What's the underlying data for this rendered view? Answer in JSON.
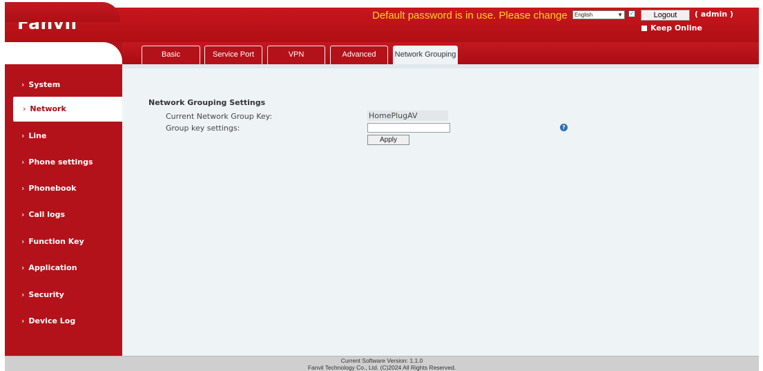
{
  "header": {
    "logo": "Fanvil",
    "warning": "Default password is in use. Please change",
    "language": "English",
    "logout_label": "Logout",
    "user": "( admin )",
    "keep_online_label": "Keep Online"
  },
  "sidebar": {
    "items": [
      {
        "label": "System"
      },
      {
        "label": "Network"
      },
      {
        "label": "Line"
      },
      {
        "label": "Phone settings"
      },
      {
        "label": "Phonebook"
      },
      {
        "label": "Call logs"
      },
      {
        "label": "Function Key"
      },
      {
        "label": "Application"
      },
      {
        "label": "Security"
      },
      {
        "label": "Device Log"
      }
    ],
    "active": "Network"
  },
  "tabs": {
    "items": [
      {
        "label": "Basic"
      },
      {
        "label": "Service Port"
      },
      {
        "label": "VPN"
      },
      {
        "label": "Advanced"
      },
      {
        "label": "Network Grouping"
      }
    ],
    "active": "Network Grouping"
  },
  "main": {
    "section_title": "Network Grouping Settings",
    "current_key_label": "Current Network Group Key:",
    "current_key_value": "HomePlugAV",
    "group_key_label": "Group key settings:",
    "group_key_value": "",
    "apply_label": "Apply",
    "help_icon": "?"
  },
  "footer": {
    "version": "Current Software Version: 1.1.0",
    "copyright": "Fanvil Technology Co., Ltd. (C)2024 All Rights Reserved."
  },
  "colors": {
    "brand_red": "#b4121a",
    "warning_yellow": "#ffd21f",
    "content_bg": "#eef3f6"
  }
}
